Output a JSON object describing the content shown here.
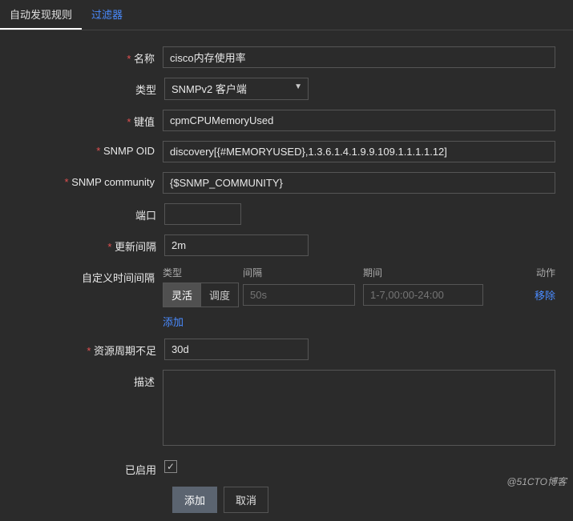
{
  "tabs": {
    "discovery": "自动发现规则",
    "filters": "过滤器"
  },
  "labels": {
    "name": "名称",
    "type": "类型",
    "key": "键值",
    "oid": "SNMP OID",
    "community": "SNMP community",
    "port": "端口",
    "interval": "更新间隔",
    "custom_intervals": "自定义时间间隔",
    "lost": "资源周期不足",
    "desc": "描述",
    "enabled": "已启用"
  },
  "values": {
    "name": "cisco内存使用率",
    "type": "SNMPv2 客户端",
    "key": "cpmCPUMemoryUsed",
    "oid": "discovery[{#MEMORYUSED},1.3.6.1.4.1.9.9.109.1.1.1.1.12]",
    "community": "{$SNMP_COMMUNITY}",
    "port": "",
    "interval": "2m",
    "lost": "30d",
    "desc": "",
    "enabled": true
  },
  "intervals": {
    "head_type": "类型",
    "head_interval": "间隔",
    "head_period": "期间",
    "head_action": "动作",
    "seg_flex": "灵活",
    "seg_sched": "调度",
    "placeholder_interval": "50s",
    "placeholder_period": "1-7,00:00-24:00",
    "remove": "移除",
    "add": "添加"
  },
  "buttons": {
    "submit": "添加",
    "cancel": "取消"
  },
  "watermark": "@51CTO博客"
}
